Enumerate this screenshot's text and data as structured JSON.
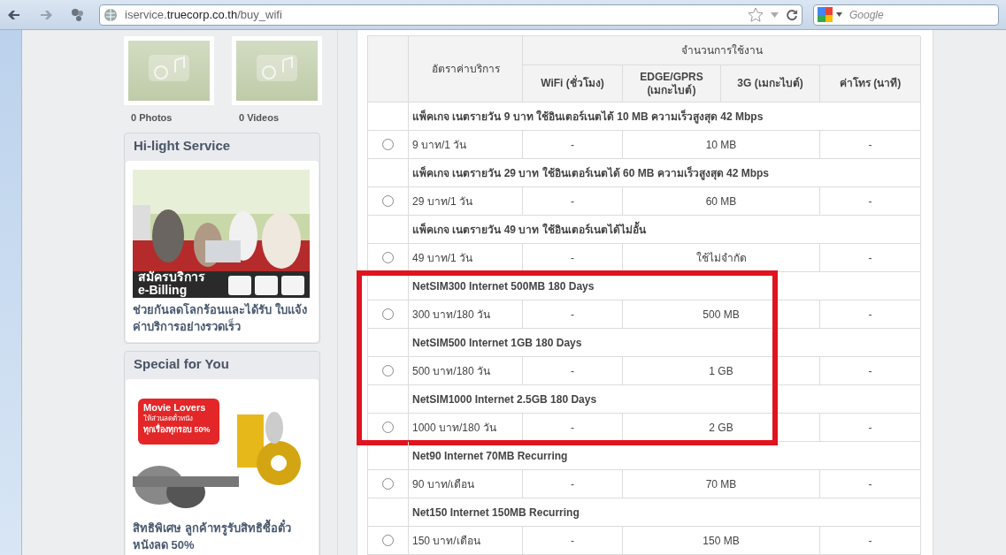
{
  "browser": {
    "url_host": "iservice.",
    "url_domain": "truecorp.co.th",
    "url_path": "/buy_wifi",
    "search_placeholder": "Google"
  },
  "sidebar": {
    "media": [
      {
        "label": "0 Photos"
      },
      {
        "label": "0 Videos"
      }
    ],
    "panels": [
      {
        "title": "Hi-light Service",
        "image_text_1": "สมัครบริการ",
        "image_text_2": "e-Billing",
        "caption": "ช่วยกันลดโลกร้อนและได้รับ ใบแจ้งค่าบริการอย่างรวดเร็ว",
        "kind": "billing"
      },
      {
        "title": "Special for You",
        "image_text_1": "Movie Lovers",
        "image_text_2": "ให้ส่วนลดตั๋วหนัง",
        "image_text_3": "ทุกเรื่องทุกรอบ 50%",
        "caption": "สิทธิพิเศษ ลูกค้าทรูรับสิทธิซื้อตั๋วหนังลด 50%",
        "kind": "movie"
      }
    ]
  },
  "table": {
    "rate_header": "อัตราค่าบริการ",
    "usage_header": "จำนวนการใช้งาน",
    "columns": [
      "WiFi (ชั่วโมง)",
      "EDGE/GPRS (เมกะไบต์)",
      "3G (เมกะไบต์)",
      "ค่าโทร (นาที)"
    ],
    "packages": [
      {
        "title": "แพ็คเกจ เนตรายวัน 9 บาท ใช้อินเตอร์เนตได้ 10 MB ความเร็วสูงสุด 42 Mbps",
        "price": "9 บาท/1 วัน",
        "wifi": "-",
        "data": "10 MB",
        "call": "-",
        "selected": false,
        "highlighted": false
      },
      {
        "title": "แพ็คเกจ เนตรายวัน 29 บาท ใช้อินเตอร์เนตได้ 60 MB ความเร็วสูงสุด 42 Mbps",
        "price": "29 บาท/1 วัน",
        "wifi": "-",
        "data": "60 MB",
        "call": "-",
        "selected": false,
        "highlighted": false
      },
      {
        "title": "แพ็คเกจ เนตรายวัน 49 บาท ใช้อินเตอร์เนตได้ไม่อั้น",
        "price": "49 บาท/1 วัน",
        "wifi": "-",
        "data": "ใช้ไม่จำกัด",
        "call": "-",
        "selected": false,
        "highlighted": false
      },
      {
        "title": "NetSIM300 Internet 500MB 180 Days",
        "price": "300 บาท/180 วัน",
        "wifi": "-",
        "data": "500 MB",
        "call": "-",
        "selected": false,
        "highlighted": true
      },
      {
        "title": "NetSIM500 Internet 1GB 180 Days",
        "price": "500 บาท/180 วัน",
        "wifi": "-",
        "data": "1 GB",
        "call": "-",
        "selected": false,
        "highlighted": true
      },
      {
        "title": "NetSIM1000 Internet 2.5GB 180 Days",
        "price": "1000 บาท/180 วัน",
        "wifi": "-",
        "data": "2 GB",
        "call": "-",
        "selected": false,
        "highlighted": true
      },
      {
        "title": "Net90 Internet 70MB Recurring",
        "price": "90 บาท/เดือน",
        "wifi": "-",
        "data": "70 MB",
        "call": "-",
        "selected": false,
        "highlighted": false
      },
      {
        "title": "Net150 Internet 150MB Recurring",
        "price": "150 บาท/เดือน",
        "wifi": "-",
        "data": "150 MB",
        "call": "-",
        "selected": false,
        "highlighted": false
      }
    ]
  }
}
